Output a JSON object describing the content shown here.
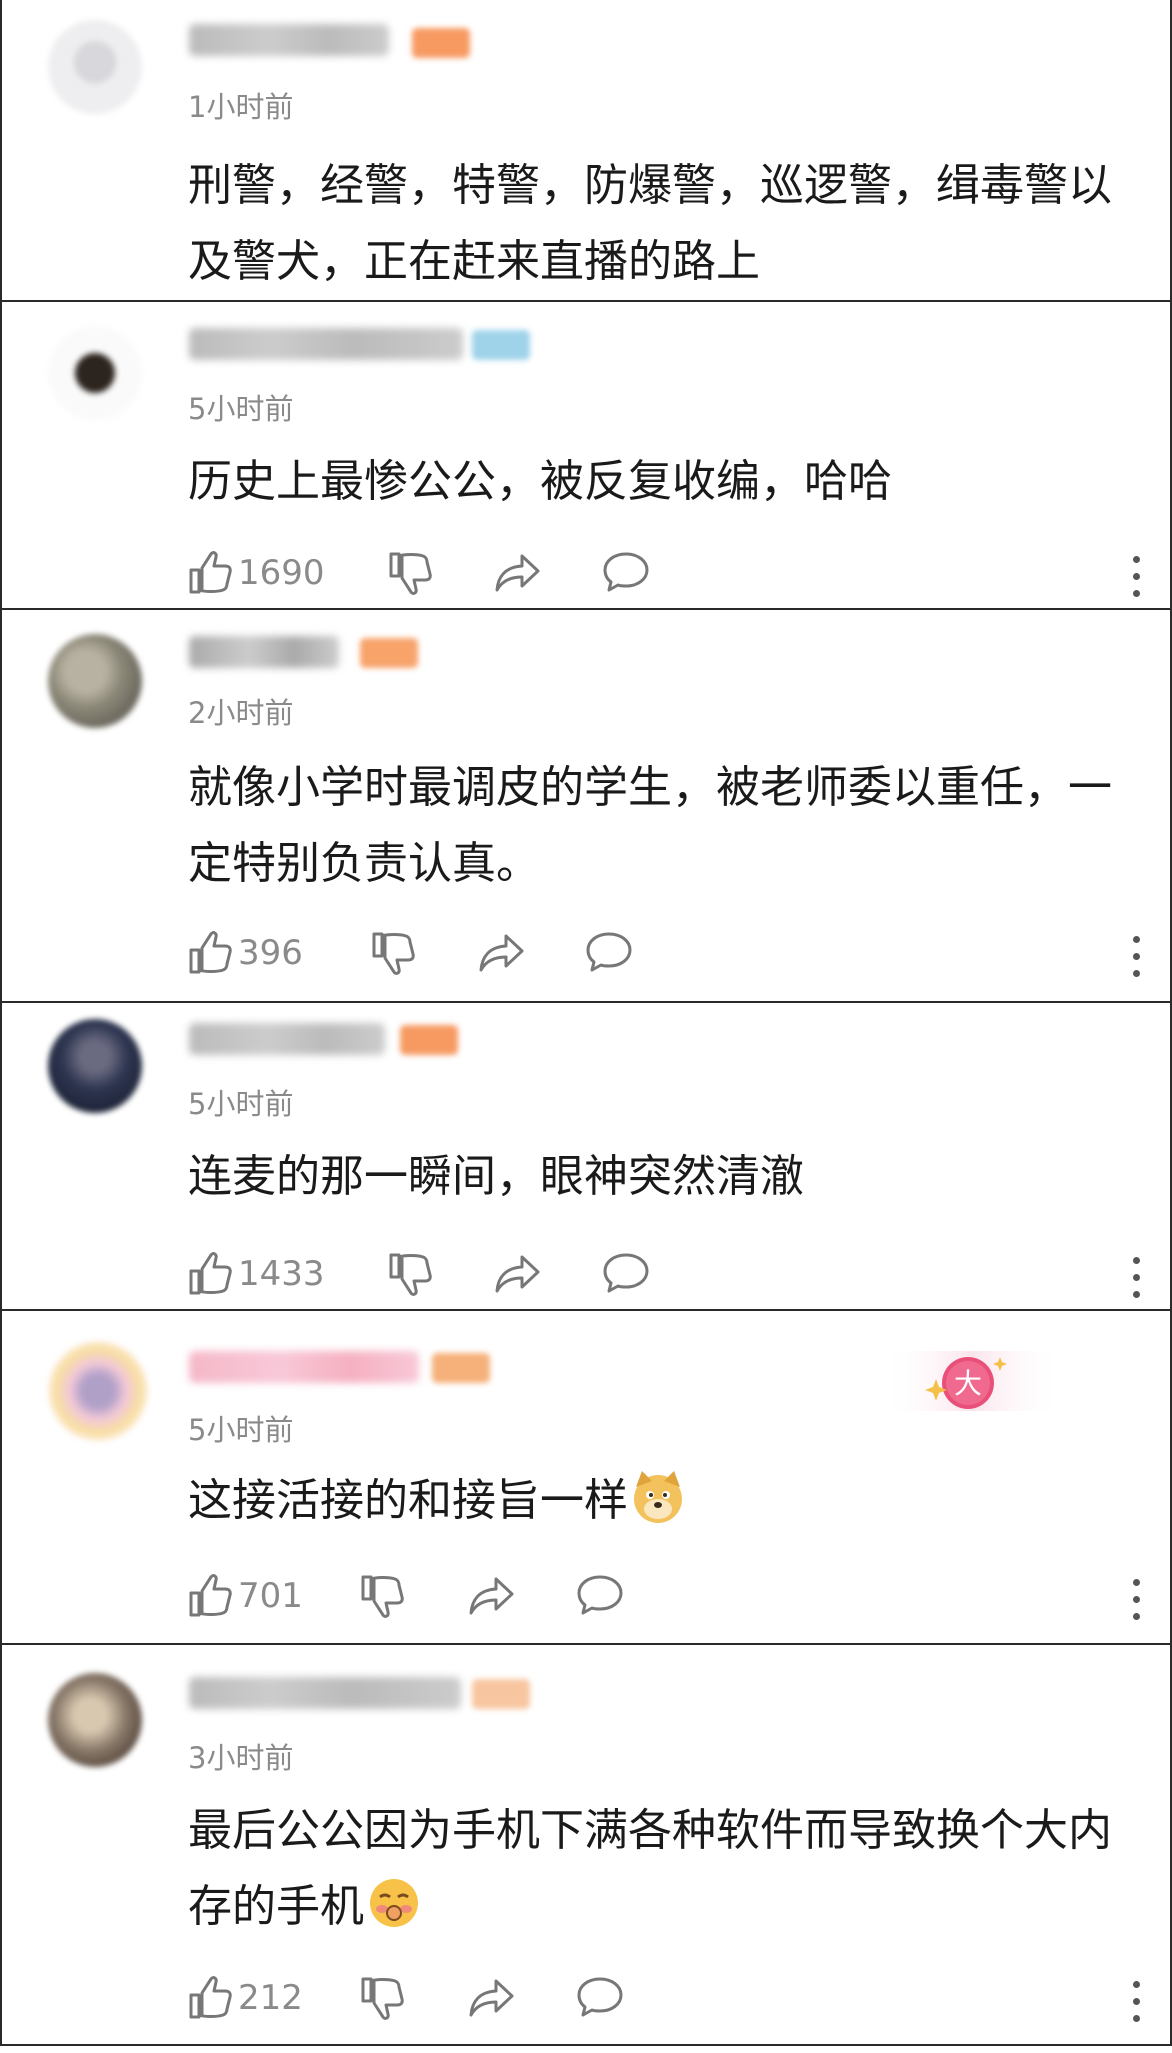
{
  "comments": [
    {
      "time": "1小时前",
      "text": "刑警，经警，特警，防爆警，巡逻警，缉毒警以及警犬，正在赶来直播的路上",
      "likes": "",
      "avatar_color": "#e8e8ec",
      "badge_color": "#f79a62"
    },
    {
      "time": "5小时前",
      "text": "历史上最惨公公，被反复收编，哈哈",
      "likes": "1690",
      "avatar_color": "#5a4a3a",
      "badge_color": "#9fd3ea"
    },
    {
      "time": "2小时前",
      "text": "就像小学时最调皮的学生，被老师委以重任，一定特别负责认真。",
      "likes": "396",
      "avatar_color": "#9a9080",
      "badge_color": "#f7a36a"
    },
    {
      "time": "5小时前",
      "text": "连麦的那一瞬间，眼神突然清澈",
      "likes": "1433",
      "avatar_color": "#3a4360",
      "badge_color": "#f79a62"
    },
    {
      "time": "5小时前",
      "text": "这接活接的和接旨一样",
      "likes": "701",
      "avatar_color": "#f0c8d8",
      "badge_color": "#f6b07a",
      "pin_label": "大"
    },
    {
      "time": "3小时前",
      "text": "最后公公因为手机下满各种软件而导致换个大内存的手机",
      "likes": "212",
      "avatar_color": "#8a7a6a",
      "badge_color": "#f7c6a0"
    }
  ],
  "icons": {
    "like": "thumbs-up-icon",
    "dislike": "thumbs-down-icon",
    "share": "share-icon",
    "reply": "comment-bubble-icon",
    "more": "more-vertical-icon"
  }
}
